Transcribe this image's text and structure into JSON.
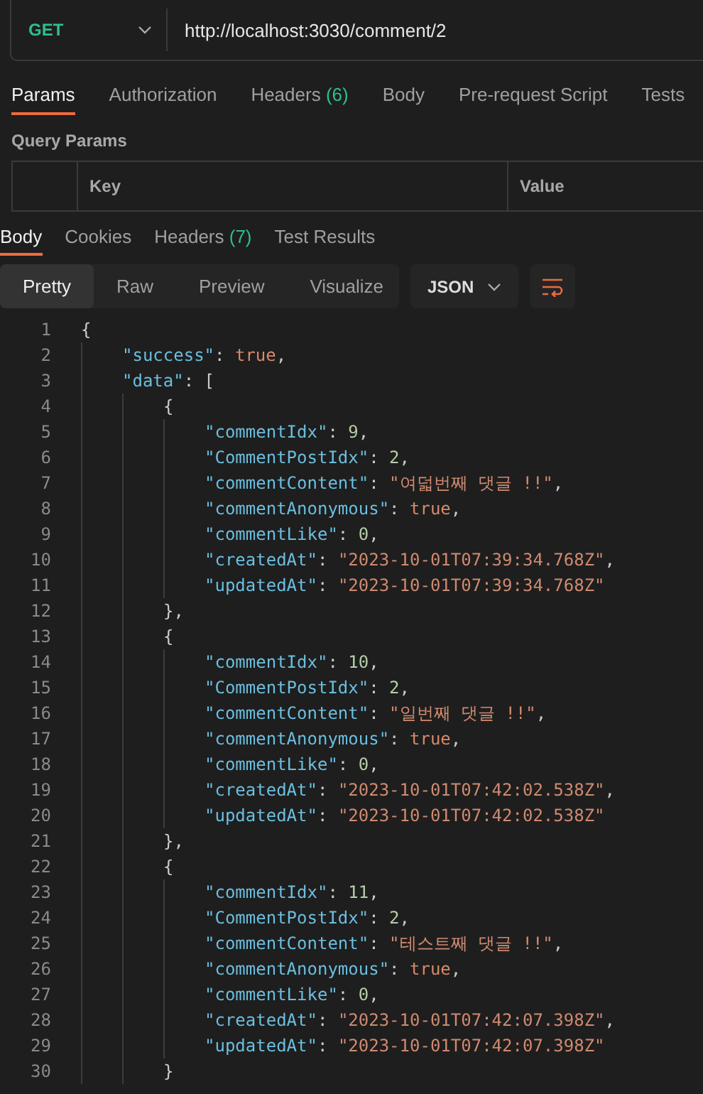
{
  "request": {
    "method": "GET",
    "url": "http://localhost:3030/comment/2"
  },
  "request_tabs": [
    {
      "label": "Params",
      "selected": true
    },
    {
      "label": "Authorization",
      "selected": false
    },
    {
      "label": "Headers",
      "count": "(6)",
      "selected": false
    },
    {
      "label": "Body",
      "selected": false
    },
    {
      "label": "Pre-request Script",
      "selected": false
    },
    {
      "label": "Tests",
      "selected": false
    }
  ],
  "query_params": {
    "title": "Query Params",
    "columns": [
      "Key",
      "Value"
    ]
  },
  "response_tabs": [
    {
      "label": "Body",
      "selected": true
    },
    {
      "label": "Cookies",
      "selected": false
    },
    {
      "label": "Headers",
      "count": "(7)",
      "selected": false
    },
    {
      "label": "Test Results",
      "selected": false
    }
  ],
  "view_modes": [
    {
      "label": "Pretty",
      "selected": true
    },
    {
      "label": "Raw",
      "selected": false
    },
    {
      "label": "Preview",
      "selected": false
    },
    {
      "label": "Visualize",
      "selected": false
    }
  ],
  "format": "JSON",
  "code": [
    {
      "number": "1",
      "tokens": [
        {
          "kind": "punct",
          "text": "{"
        }
      ],
      "children": [
        {
          "number": "2",
          "tokens": [
            {
              "kind": "key",
              "text": "\"success\""
            },
            {
              "kind": "punct",
              "text": ": "
            },
            {
              "kind": "bool",
              "text": "true"
            },
            {
              "kind": "punct",
              "text": ","
            }
          ]
        },
        {
          "number": "3",
          "tokens": [
            {
              "kind": "key",
              "text": "\"data\""
            },
            {
              "kind": "punct",
              "text": ": ["
            }
          ],
          "children": [
            {
              "number": "4",
              "tokens": [
                {
                  "kind": "punct",
                  "text": "{"
                }
              ],
              "children": [
                {
                  "number": "5",
                  "tokens": [
                    {
                      "kind": "key",
                      "text": "\"commentIdx\""
                    },
                    {
                      "kind": "punct",
                      "text": ": "
                    },
                    {
                      "kind": "num",
                      "text": "9"
                    },
                    {
                      "kind": "punct",
                      "text": ","
                    }
                  ]
                },
                {
                  "number": "6",
                  "tokens": [
                    {
                      "kind": "key",
                      "text": "\"CommentPostIdx\""
                    },
                    {
                      "kind": "punct",
                      "text": ": "
                    },
                    {
                      "kind": "num",
                      "text": "2"
                    },
                    {
                      "kind": "punct",
                      "text": ","
                    }
                  ]
                },
                {
                  "number": "7",
                  "tokens": [
                    {
                      "kind": "key",
                      "text": "\"commentContent\""
                    },
                    {
                      "kind": "punct",
                      "text": ": "
                    },
                    {
                      "kind": "str",
                      "text": "\"여덟번째 댓글 !!\""
                    },
                    {
                      "kind": "punct",
                      "text": ","
                    }
                  ]
                },
                {
                  "number": "8",
                  "tokens": [
                    {
                      "kind": "key",
                      "text": "\"commentAnonymous\""
                    },
                    {
                      "kind": "punct",
                      "text": ": "
                    },
                    {
                      "kind": "bool",
                      "text": "true"
                    },
                    {
                      "kind": "punct",
                      "text": ","
                    }
                  ]
                },
                {
                  "number": "9",
                  "tokens": [
                    {
                      "kind": "key",
                      "text": "\"commentLike\""
                    },
                    {
                      "kind": "punct",
                      "text": ": "
                    },
                    {
                      "kind": "num",
                      "text": "0"
                    },
                    {
                      "kind": "punct",
                      "text": ","
                    }
                  ]
                },
                {
                  "number": "10",
                  "tokens": [
                    {
                      "kind": "key",
                      "text": "\"createdAt\""
                    },
                    {
                      "kind": "punct",
                      "text": ": "
                    },
                    {
                      "kind": "str",
                      "text": "\"2023-10-01T07:39:34.768Z\""
                    },
                    {
                      "kind": "punct",
                      "text": ","
                    }
                  ]
                },
                {
                  "number": "11",
                  "tokens": [
                    {
                      "kind": "key",
                      "text": "\"updatedAt\""
                    },
                    {
                      "kind": "punct",
                      "text": ": "
                    },
                    {
                      "kind": "str",
                      "text": "\"2023-10-01T07:39:34.768Z\""
                    }
                  ]
                }
              ]
            },
            {
              "number": "12",
              "tokens": [
                {
                  "kind": "punct",
                  "text": "},"
                }
              ]
            },
            {
              "number": "13",
              "tokens": [
                {
                  "kind": "punct",
                  "text": "{"
                }
              ],
              "children": [
                {
                  "number": "14",
                  "tokens": [
                    {
                      "kind": "key",
                      "text": "\"commentIdx\""
                    },
                    {
                      "kind": "punct",
                      "text": ": "
                    },
                    {
                      "kind": "num",
                      "text": "10"
                    },
                    {
                      "kind": "punct",
                      "text": ","
                    }
                  ]
                },
                {
                  "number": "15",
                  "tokens": [
                    {
                      "kind": "key",
                      "text": "\"CommentPostIdx\""
                    },
                    {
                      "kind": "punct",
                      "text": ": "
                    },
                    {
                      "kind": "num",
                      "text": "2"
                    },
                    {
                      "kind": "punct",
                      "text": ","
                    }
                  ]
                },
                {
                  "number": "16",
                  "tokens": [
                    {
                      "kind": "key",
                      "text": "\"commentContent\""
                    },
                    {
                      "kind": "punct",
                      "text": ": "
                    },
                    {
                      "kind": "str",
                      "text": "\"일번째 댓글 !!\""
                    },
                    {
                      "kind": "punct",
                      "text": ","
                    }
                  ]
                },
                {
                  "number": "17",
                  "tokens": [
                    {
                      "kind": "key",
                      "text": "\"commentAnonymous\""
                    },
                    {
                      "kind": "punct",
                      "text": ": "
                    },
                    {
                      "kind": "bool",
                      "text": "true"
                    },
                    {
                      "kind": "punct",
                      "text": ","
                    }
                  ]
                },
                {
                  "number": "18",
                  "tokens": [
                    {
                      "kind": "key",
                      "text": "\"commentLike\""
                    },
                    {
                      "kind": "punct",
                      "text": ": "
                    },
                    {
                      "kind": "num",
                      "text": "0"
                    },
                    {
                      "kind": "punct",
                      "text": ","
                    }
                  ]
                },
                {
                  "number": "19",
                  "tokens": [
                    {
                      "kind": "key",
                      "text": "\"createdAt\""
                    },
                    {
                      "kind": "punct",
                      "text": ": "
                    },
                    {
                      "kind": "str",
                      "text": "\"2023-10-01T07:42:02.538Z\""
                    },
                    {
                      "kind": "punct",
                      "text": ","
                    }
                  ]
                },
                {
                  "number": "20",
                  "tokens": [
                    {
                      "kind": "key",
                      "text": "\"updatedAt\""
                    },
                    {
                      "kind": "punct",
                      "text": ": "
                    },
                    {
                      "kind": "str",
                      "text": "\"2023-10-01T07:42:02.538Z\""
                    }
                  ]
                }
              ]
            },
            {
              "number": "21",
              "tokens": [
                {
                  "kind": "punct",
                  "text": "},"
                }
              ]
            },
            {
              "number": "22",
              "tokens": [
                {
                  "kind": "punct",
                  "text": "{"
                }
              ],
              "children": [
                {
                  "number": "23",
                  "tokens": [
                    {
                      "kind": "key",
                      "text": "\"commentIdx\""
                    },
                    {
                      "kind": "punct",
                      "text": ": "
                    },
                    {
                      "kind": "num",
                      "text": "11"
                    },
                    {
                      "kind": "punct",
                      "text": ","
                    }
                  ]
                },
                {
                  "number": "24",
                  "tokens": [
                    {
                      "kind": "key",
                      "text": "\"CommentPostIdx\""
                    },
                    {
                      "kind": "punct",
                      "text": ": "
                    },
                    {
                      "kind": "num",
                      "text": "2"
                    },
                    {
                      "kind": "punct",
                      "text": ","
                    }
                  ]
                },
                {
                  "number": "25",
                  "tokens": [
                    {
                      "kind": "key",
                      "text": "\"commentContent\""
                    },
                    {
                      "kind": "punct",
                      "text": ": "
                    },
                    {
                      "kind": "str",
                      "text": "\"테스트째 댓글 !!\""
                    },
                    {
                      "kind": "punct",
                      "text": ","
                    }
                  ]
                },
                {
                  "number": "26",
                  "tokens": [
                    {
                      "kind": "key",
                      "text": "\"commentAnonymous\""
                    },
                    {
                      "kind": "punct",
                      "text": ": "
                    },
                    {
                      "kind": "bool",
                      "text": "true"
                    },
                    {
                      "kind": "punct",
                      "text": ","
                    }
                  ]
                },
                {
                  "number": "27",
                  "tokens": [
                    {
                      "kind": "key",
                      "text": "\"commentLike\""
                    },
                    {
                      "kind": "punct",
                      "text": ": "
                    },
                    {
                      "kind": "num",
                      "text": "0"
                    },
                    {
                      "kind": "punct",
                      "text": ","
                    }
                  ]
                },
                {
                  "number": "28",
                  "tokens": [
                    {
                      "kind": "key",
                      "text": "\"createdAt\""
                    },
                    {
                      "kind": "punct",
                      "text": ": "
                    },
                    {
                      "kind": "str",
                      "text": "\"2023-10-01T07:42:07.398Z\""
                    },
                    {
                      "kind": "punct",
                      "text": ","
                    }
                  ]
                },
                {
                  "number": "29",
                  "tokens": [
                    {
                      "kind": "key",
                      "text": "\"updatedAt\""
                    },
                    {
                      "kind": "punct",
                      "text": ": "
                    },
                    {
                      "kind": "str",
                      "text": "\"2023-10-01T07:42:07.398Z\""
                    }
                  ]
                }
              ]
            },
            {
              "number": "30",
              "tokens": [
                {
                  "kind": "punct",
                  "text": "}"
                }
              ]
            }
          ]
        }
      ]
    }
  ]
}
